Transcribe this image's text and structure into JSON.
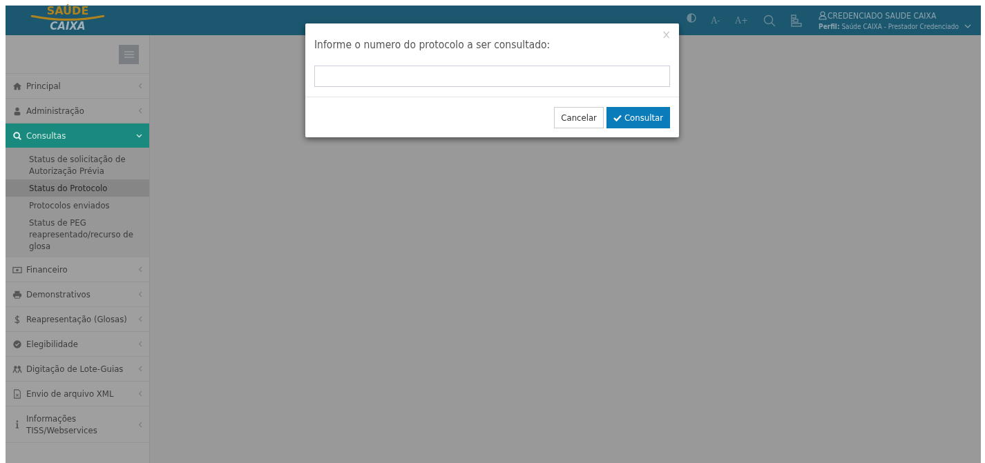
{
  "logo": {
    "line1": "SAÚDE",
    "line2": "CAIXA"
  },
  "header": {
    "tools": [
      {
        "kind": "contrast"
      },
      {
        "kind": "text",
        "label": "A-"
      },
      {
        "kind": "text",
        "label": "A+"
      },
      {
        "kind": "search"
      },
      {
        "kind": "sitemap"
      }
    ],
    "user": "CREDENCIADO SAUDE CAIXA",
    "profile_label": "Perfil:",
    "profile": "Saúde CAIXA - Prestador Credenciado"
  },
  "sidebar": {
    "items": [
      {
        "label": "Principal",
        "selected": false,
        "expanded": false
      },
      {
        "label": "Administração",
        "selected": false,
        "expanded": false
      },
      {
        "label": "Consultas",
        "selected": true,
        "expanded": true,
        "children": [
          {
            "label": "Status de solicitação de Autorização Prévia",
            "selected": false
          },
          {
            "label": "Status do Protocolo",
            "selected": true
          },
          {
            "label": "Protocolos enviados",
            "selected": false
          },
          {
            "label": "Status de PEG reapresentado/recurso de glosa",
            "selected": false
          }
        ]
      },
      {
        "label": "Financeiro",
        "selected": false,
        "expanded": false
      },
      {
        "label": "Demonstrativos",
        "selected": false,
        "expanded": false
      },
      {
        "label": "Reapresentação (Glosas)",
        "selected": false,
        "expanded": false
      },
      {
        "label": "Elegibilidade",
        "selected": false,
        "expanded": false
      },
      {
        "label": "Digitação de Lote-Guias",
        "selected": false,
        "expanded": false
      },
      {
        "label": "Envio de arquivo XML",
        "selected": false,
        "expanded": false
      },
      {
        "label": "Informações TISS/Webservices",
        "selected": false,
        "expanded": false
      }
    ]
  },
  "modal": {
    "close": "×",
    "message": "Informe o numero do protocolo a ser consultado:",
    "buttons": [
      {
        "label": "Cancelar",
        "kind": "default"
      },
      {
        "label": "Consultar",
        "kind": "primary"
      }
    ]
  }
}
